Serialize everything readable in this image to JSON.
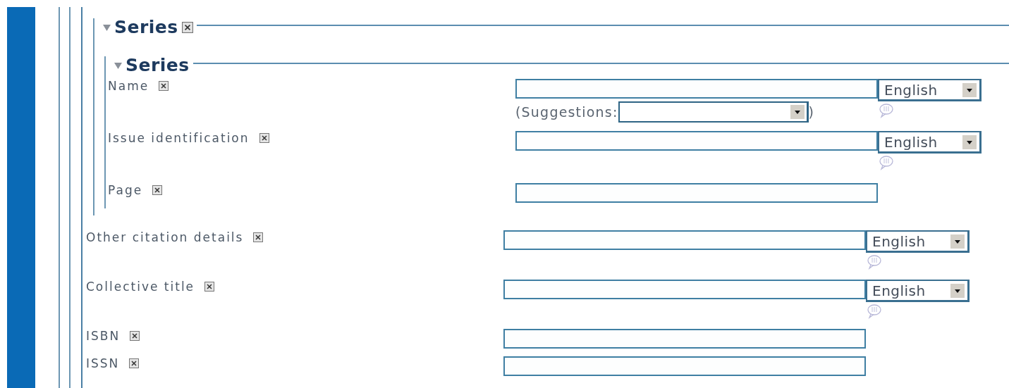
{
  "section": {
    "title": "Series",
    "removable": true,
    "expanded": true,
    "subsection": {
      "title": "Series",
      "expanded": true,
      "fields": [
        {
          "label": "Name",
          "kind": "multilingual",
          "language": "English",
          "suggestions": {
            "prefix": "(Suggestions:",
            "suffix": ")"
          }
        },
        {
          "label": "Issue identification",
          "kind": "multilingual",
          "language": "English"
        },
        {
          "label": "Page",
          "kind": "text"
        }
      ]
    }
  },
  "fields": [
    {
      "label": "Other citation details",
      "kind": "multilingual",
      "language": "English"
    },
    {
      "label": "Collective title",
      "kind": "multilingual",
      "language": "English"
    },
    {
      "label": "ISBN",
      "kind": "text"
    },
    {
      "label": "ISSN",
      "kind": "text"
    }
  ]
}
